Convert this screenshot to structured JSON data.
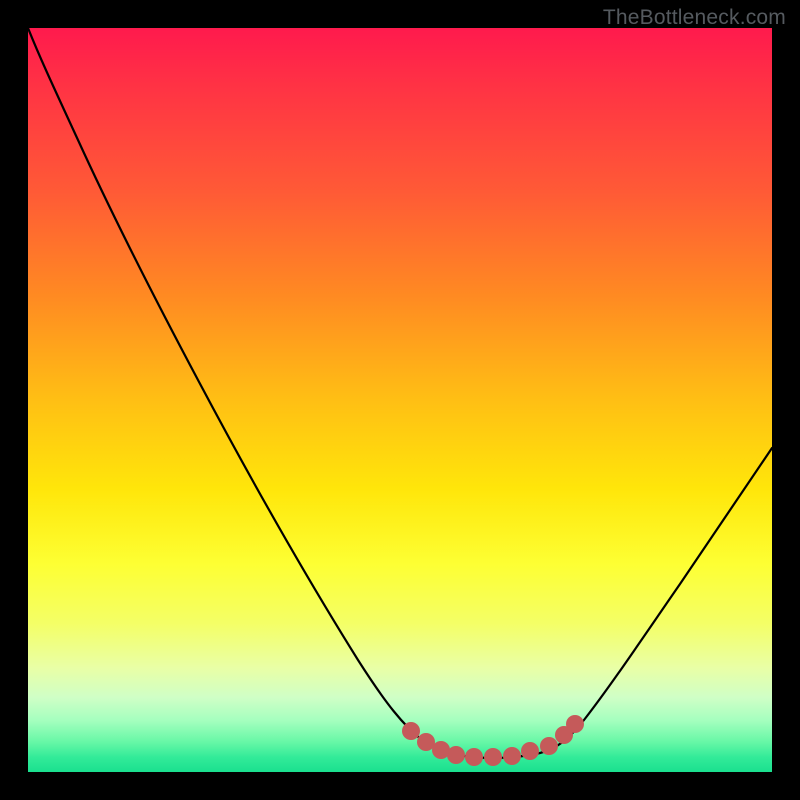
{
  "watermark": {
    "text": "TheBottleneck.com"
  },
  "chart_data": {
    "type": "line",
    "title": "",
    "xlabel": "",
    "ylabel": "",
    "xlim": [
      0,
      1
    ],
    "ylim": [
      0,
      1
    ],
    "series": [
      {
        "name": "curve",
        "x": [
          0.0,
          0.04,
          0.1,
          0.18,
          0.26,
          0.34,
          0.42,
          0.48,
          0.52,
          0.56,
          0.6,
          0.66,
          0.7,
          0.76,
          0.84,
          0.92,
          1.0
        ],
        "y": [
          1.0,
          0.945,
          0.84,
          0.69,
          0.53,
          0.37,
          0.21,
          0.1,
          0.055,
          0.03,
          0.02,
          0.02,
          0.03,
          0.07,
          0.16,
          0.27,
          0.4
        ]
      },
      {
        "name": "highlight-dots",
        "x": [
          0.515,
          0.535,
          0.555,
          0.575,
          0.6,
          0.625,
          0.65,
          0.675,
          0.7,
          0.72,
          0.735
        ],
        "y": [
          0.055,
          0.04,
          0.03,
          0.024,
          0.02,
          0.02,
          0.022,
          0.028,
          0.035,
          0.05,
          0.065
        ]
      }
    ],
    "colors": {
      "curve": "#000000",
      "dots": "#c55a5a",
      "gradient_top": "#ff1a4d",
      "gradient_mid": "#ffe60a",
      "gradient_bottom": "#1ae08f"
    }
  }
}
